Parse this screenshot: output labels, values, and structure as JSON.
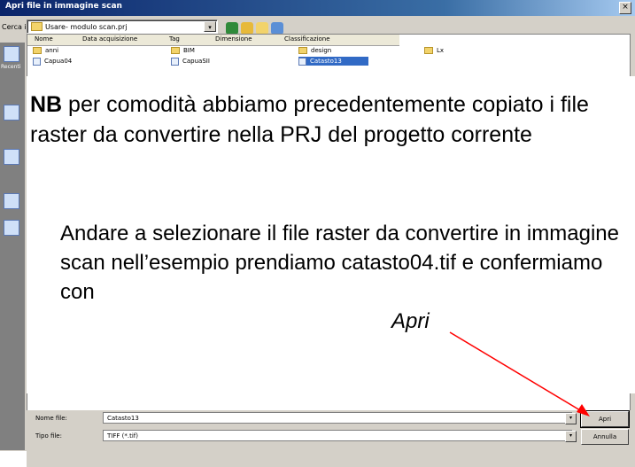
{
  "window": {
    "title": "Apri file in immagine scan",
    "close_glyph": "×"
  },
  "toolbar": {
    "look_in_label": "Cerca in:",
    "look_in_value": "Usare- modulo scan.prj",
    "dropdown_glyph": "▾",
    "icons": [
      "back-icon",
      "up-folder-icon",
      "new-folder-icon",
      "view-menu-icon"
    ]
  },
  "places_bar": {
    "items": [
      "recent-icon",
      "desktop-icon",
      "documents-icon",
      "computer-icon",
      "network-icon"
    ],
    "recent_label": "Recenti"
  },
  "file_list": {
    "columns": [
      "Nome",
      "Data acquisizione",
      "Tag",
      "Dimensione",
      "Classificazione"
    ],
    "items": [
      {
        "name": "anni",
        "type": "folder"
      },
      {
        "name": "BIM",
        "type": "folder"
      },
      {
        "name": "design",
        "type": "folder"
      },
      {
        "name": "Lx",
        "type": "folder"
      },
      {
        "name": "Capua04",
        "type": "file"
      },
      {
        "name": "CapuaSII",
        "type": "file"
      },
      {
        "name": "Catasto13",
        "type": "file",
        "selected": true
      }
    ]
  },
  "annotations": {
    "note1_bold": "NB",
    "note1_text": " per comodità abbiamo precedentemente copiato i file raster da convertire nella PRJ del progetto corrente",
    "note2_text": "Andare a selezionare il file raster da convertire in immagine scan nell’esempio prendiamo catasto04.tif  e confermiamo con",
    "note2_apri": "Apri",
    "arrow_color": "#ff0000"
  },
  "footer": {
    "filename_label": "Nome file:",
    "filename_value": "Catasto13",
    "filetype_label": "Tipo file:",
    "filetype_value": "TIFF (*.tif)",
    "open_button": "Apri",
    "cancel_button": "Annulla"
  }
}
